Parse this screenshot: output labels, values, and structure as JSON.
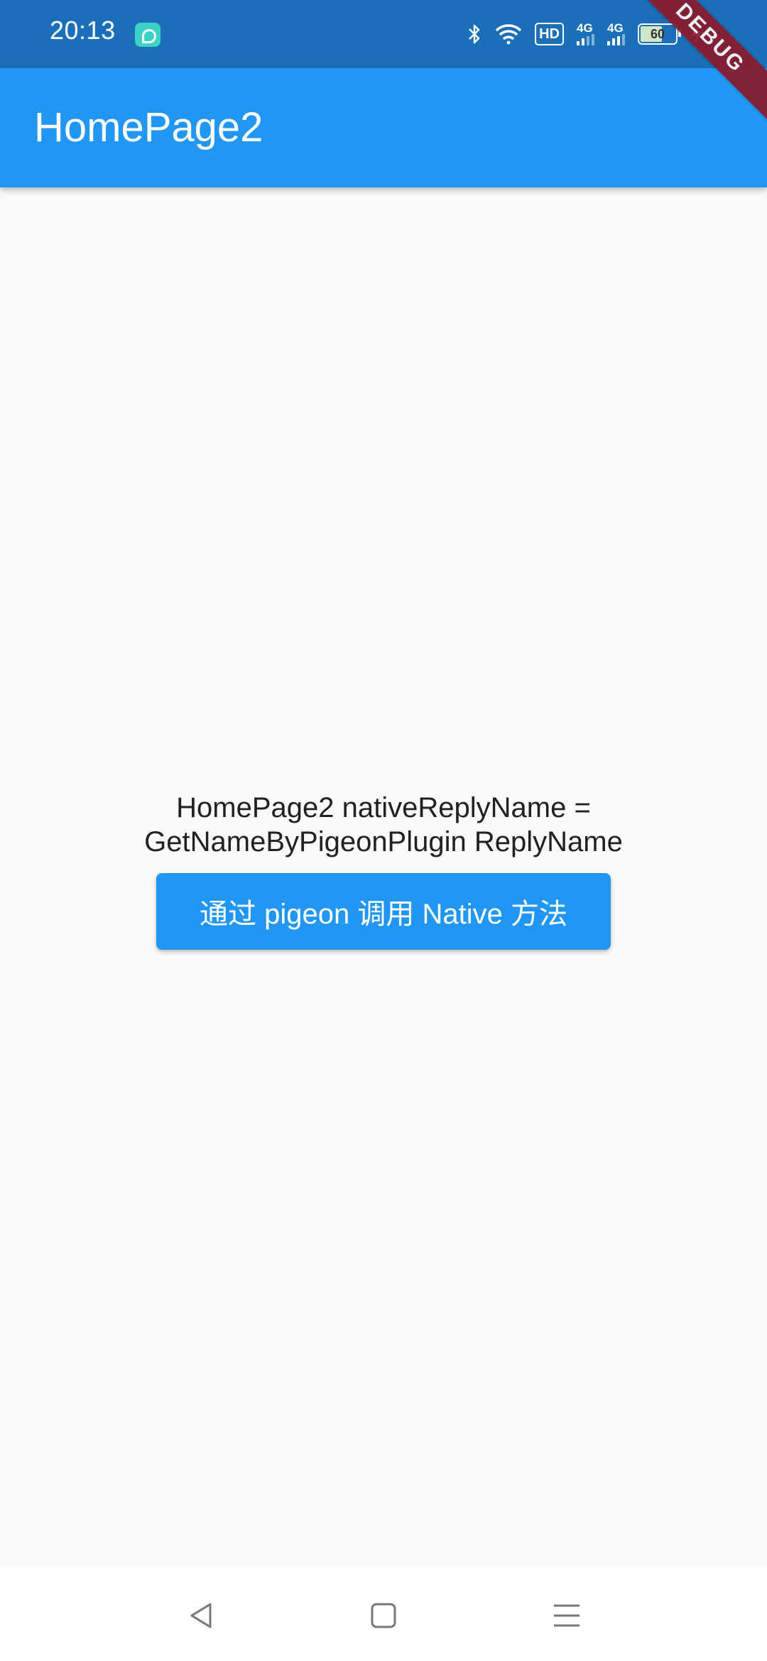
{
  "status_bar": {
    "time": "20:13",
    "network_1": "4G",
    "network_2": "4G",
    "hd_label": "HD",
    "battery_level": "60"
  },
  "debug_banner": "DEBUG",
  "app_bar": {
    "title": "HomePage2"
  },
  "main": {
    "message_line1": "HomePage2 nativeReplyName =",
    "message_line2": "GetNameByPigeonPlugin ReplyName",
    "button_label": "通过 pigeon 调用 Native 方法"
  },
  "colors": {
    "app_bar": "#2196f3",
    "status_bar": "#1a6fb8",
    "background": "#fafafa",
    "button": "#2196f3"
  },
  "icons": {
    "nav_back": "back-triangle-icon",
    "nav_home": "home-square-icon",
    "nav_menu": "menu-lines-icon"
  }
}
